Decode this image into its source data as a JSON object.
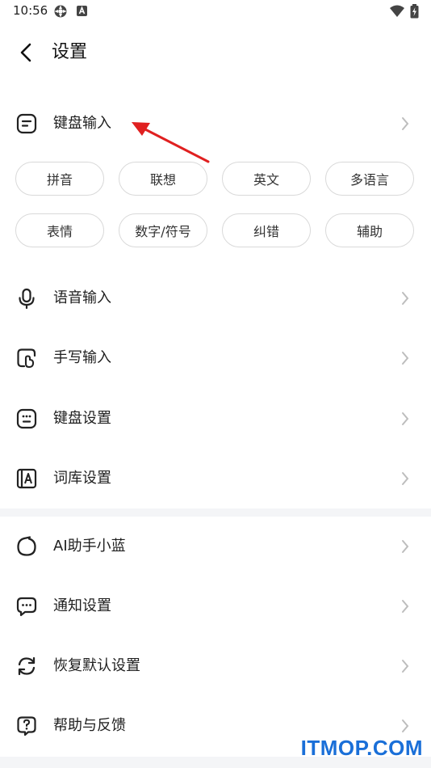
{
  "status_bar": {
    "time": "10:56",
    "icons": [
      "settings-gear-icon",
      "keyboard-a-icon",
      "wifi-icon",
      "battery-charging-icon"
    ]
  },
  "header": {
    "title": "设置",
    "back_icon": "chevron-left-icon"
  },
  "keyboard_section": {
    "label": "键盘输入",
    "icon": "keyboard-input-icon",
    "chips": [
      "拼音",
      "联想",
      "英文",
      "多语言",
      "表情",
      "数字/符号",
      "纠错",
      "辅助"
    ]
  },
  "group1": [
    {
      "label": "语音输入",
      "icon": "microphone-icon"
    },
    {
      "label": "手写输入",
      "icon": "handwriting-icon"
    },
    {
      "label": "键盘设置",
      "icon": "keyboard-settings-icon"
    },
    {
      "label": "词库设置",
      "icon": "dictionary-icon"
    }
  ],
  "group2": [
    {
      "label": "AI助手小蓝",
      "icon": "ai-assistant-icon"
    },
    {
      "label": "通知设置",
      "icon": "notification-icon"
    },
    {
      "label": "恢复默认设置",
      "icon": "reset-icon"
    },
    {
      "label": "帮助与反馈",
      "icon": "help-icon"
    }
  ],
  "colors": {
    "annotation_arrow": "#e02020",
    "divider": "#f4f5f7",
    "chip_border": "#d9d9d9",
    "watermark": "#1a6fd8"
  },
  "watermark": "ITMOP.COM"
}
